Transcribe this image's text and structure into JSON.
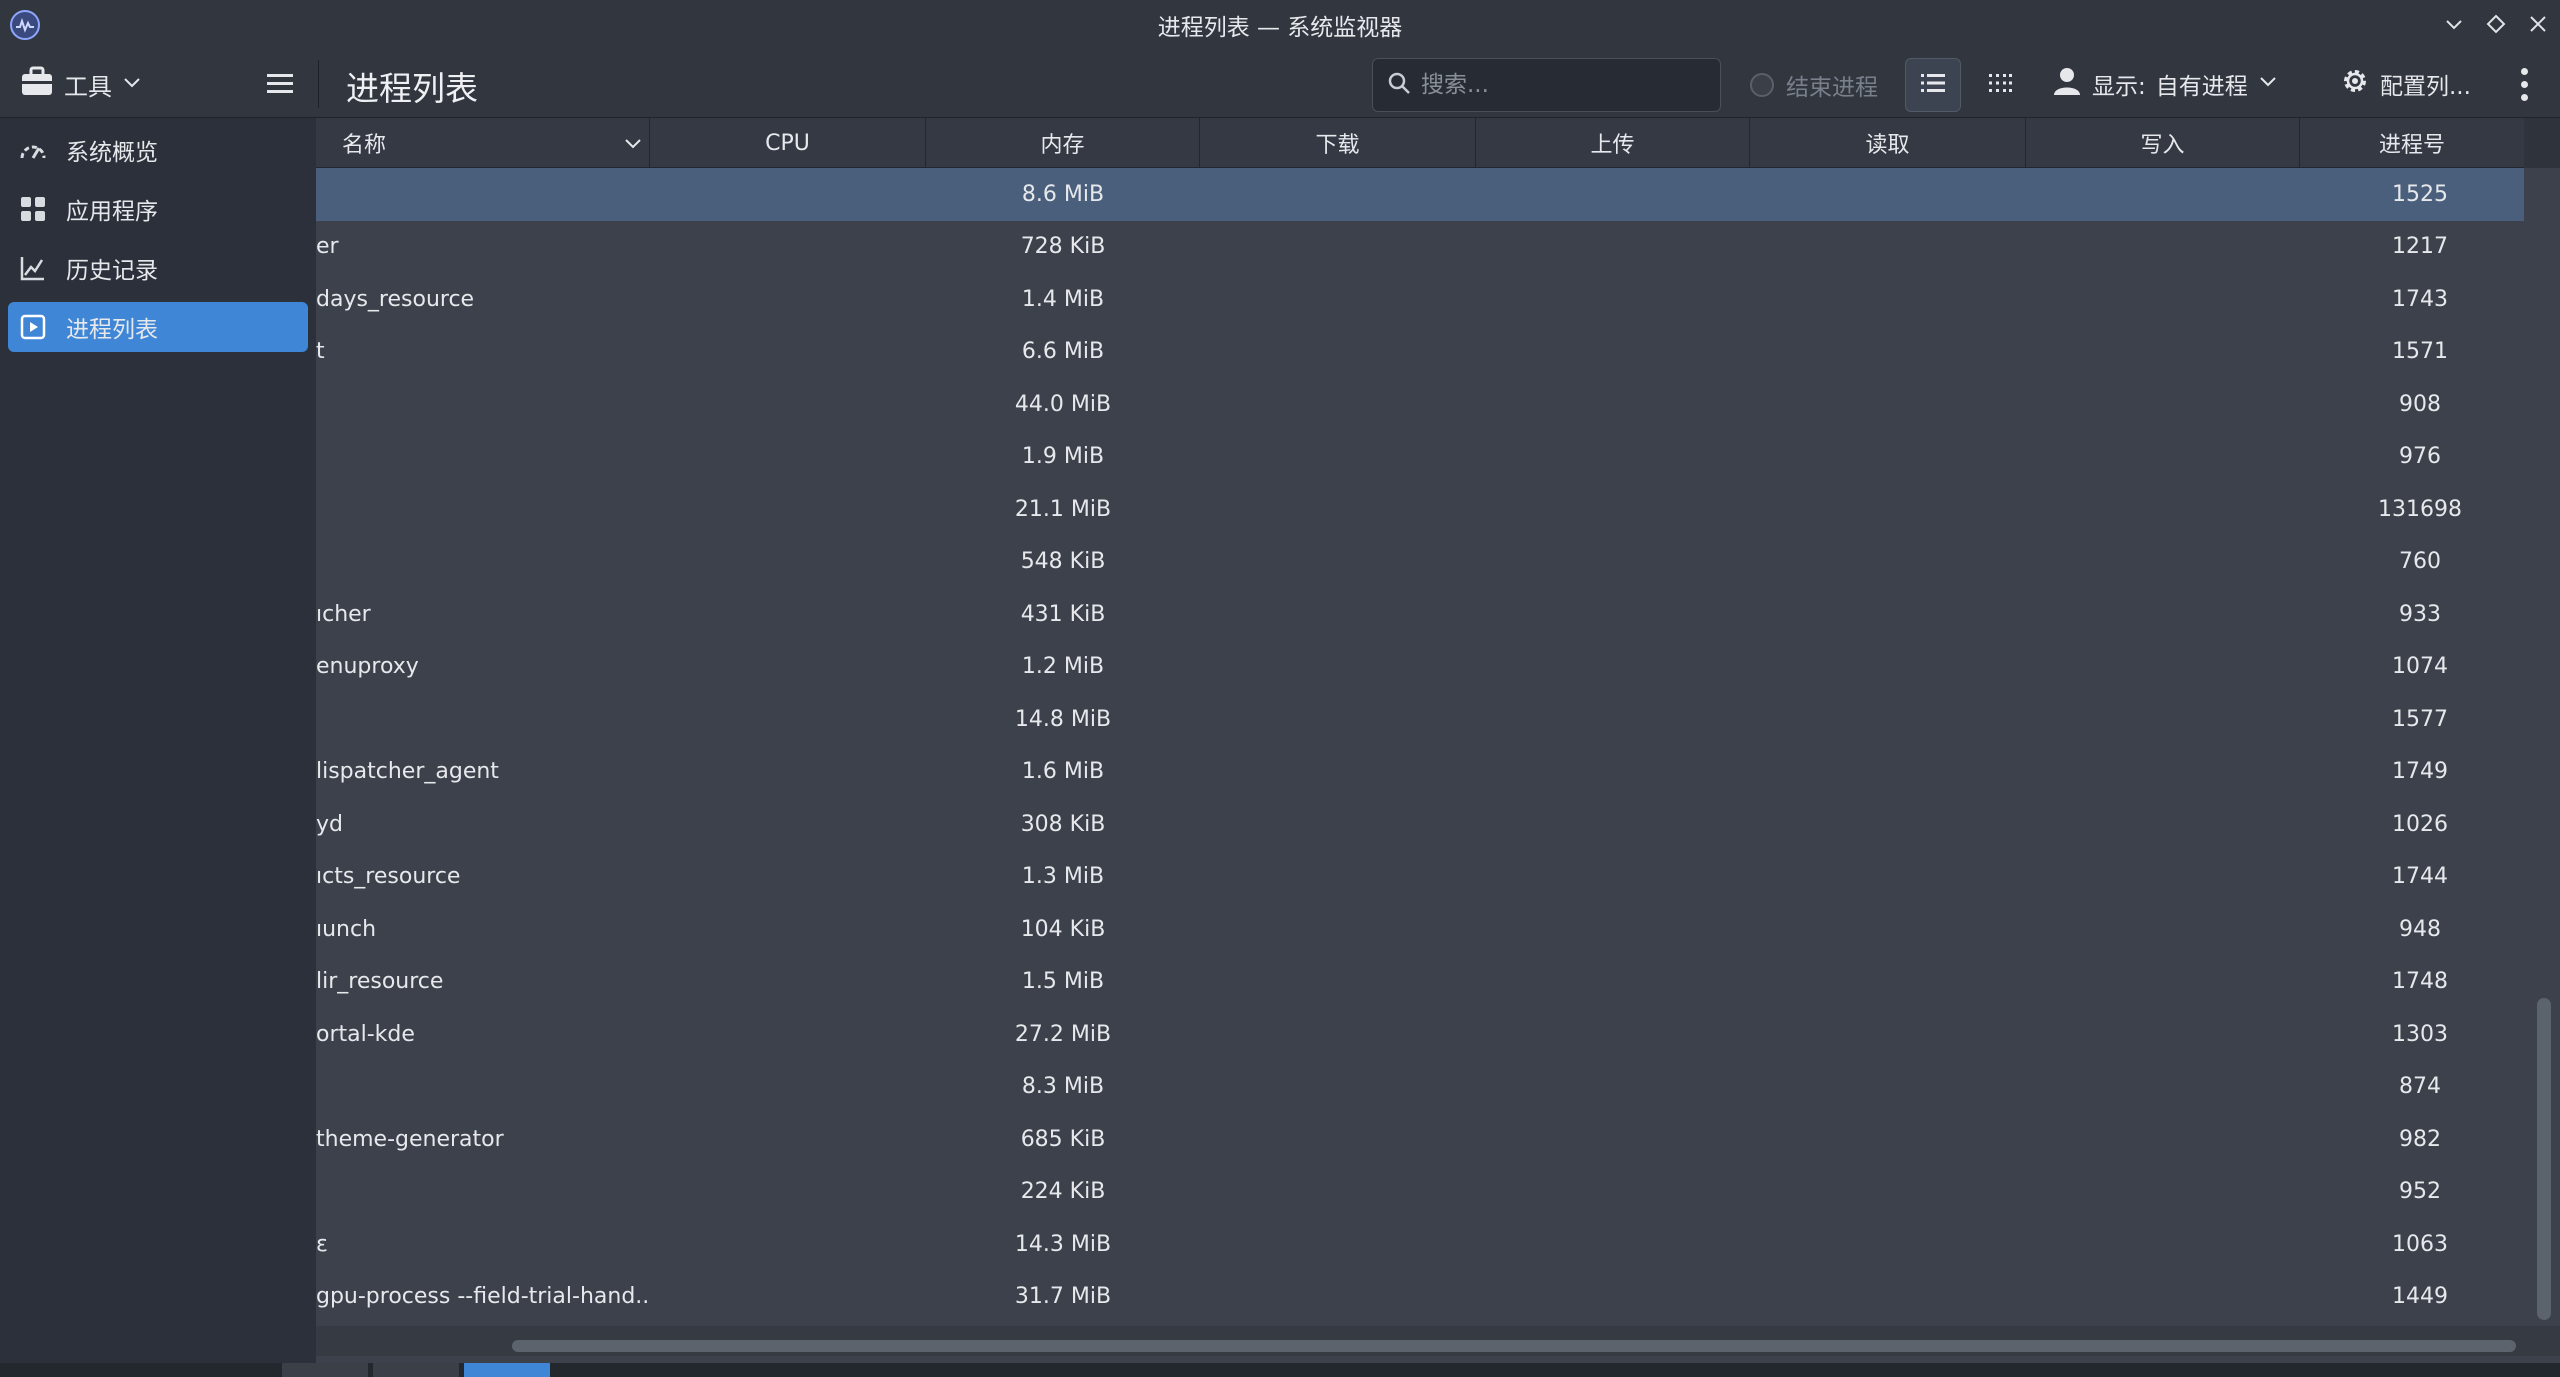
{
  "window": {
    "title": "进程列表 — 系统监视器",
    "controls": [
      "minimize",
      "maximize",
      "close"
    ]
  },
  "toolbar": {
    "tools_label": "工具",
    "page_title": "进程列表",
    "search_placeholder": "搜索...",
    "end_process_label": "结束进程",
    "display_label": "显示:",
    "display_value": "自有进程",
    "configure_columns_label": "配置列..."
  },
  "sidebar": {
    "items": [
      {
        "label": "系统概览",
        "icon": "overview-icon",
        "active": false
      },
      {
        "label": "应用程序",
        "icon": "apps-grid-icon",
        "active": false
      },
      {
        "label": "历史记录",
        "icon": "history-chart-icon",
        "active": false
      },
      {
        "label": "进程列表",
        "icon": "process-list-icon",
        "active": true
      }
    ]
  },
  "table": {
    "columns": {
      "name": "名称",
      "cpu": "CPU",
      "memory": "内存",
      "download": "下载",
      "upload": "上传",
      "read": "读取",
      "write": "写入",
      "pid": "进程号"
    },
    "rows": [
      {
        "name": "",
        "memory": "8.6 MiB",
        "pid": "1525"
      },
      {
        "name": "er",
        "memory": "728 KiB",
        "pid": "1217"
      },
      {
        "name": "days_resource",
        "memory": "1.4 MiB",
        "pid": "1743"
      },
      {
        "name": "t",
        "memory": "6.6 MiB",
        "pid": "1571"
      },
      {
        "name": "",
        "memory": "44.0 MiB",
        "pid": "908"
      },
      {
        "name": "",
        "memory": "1.9 MiB",
        "pid": "976"
      },
      {
        "name": "",
        "memory": "21.1 MiB",
        "pid": "131698"
      },
      {
        "name": "",
        "memory": "548 KiB",
        "pid": "760"
      },
      {
        "name": "ıcher",
        "memory": "431 KiB",
        "pid": "933"
      },
      {
        "name": "enuproxy",
        "memory": "1.2 MiB",
        "pid": "1074"
      },
      {
        "name": "",
        "memory": "14.8 MiB",
        "pid": "1577"
      },
      {
        "name": "lispatcher_agent",
        "memory": "1.6 MiB",
        "pid": "1749"
      },
      {
        "name": "yd",
        "memory": "308 KiB",
        "pid": "1026"
      },
      {
        "name": "ıcts_resource",
        "memory": "1.3 MiB",
        "pid": "1744"
      },
      {
        "name": "ıunch",
        "memory": "104 KiB",
        "pid": "948"
      },
      {
        "name": "lir_resource",
        "memory": "1.5 MiB",
        "pid": "1748"
      },
      {
        "name": "ortal-kde",
        "memory": "27.2 MiB",
        "pid": "1303"
      },
      {
        "name": "",
        "memory": "8.3 MiB",
        "pid": "874"
      },
      {
        "name": "theme-generator",
        "memory": "685 KiB",
        "pid": "982"
      },
      {
        "name": "",
        "memory": "224 KiB",
        "pid": "952"
      },
      {
        "name": "ε",
        "memory": "14.3 MiB",
        "pid": "1063"
      },
      {
        "name": "gpu-process --field-trial-hand...",
        "memory": "31.7 MiB",
        "pid": "1449"
      }
    ]
  },
  "colors": {
    "accent": "#3f86d6",
    "selected_row": "#4a5f7c",
    "background": "#3c414b",
    "sidebar": "#2b303a"
  }
}
